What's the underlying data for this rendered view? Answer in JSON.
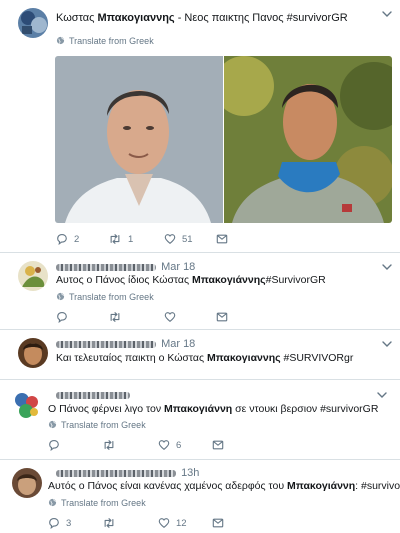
{
  "colors": {
    "icon": "#657786",
    "text": "#14171a",
    "divider": "#d9e0e4"
  },
  "tweets": [
    {
      "author_name": "Κωστας",
      "author_bold": "Μπακογιαννης",
      "body": "- Νεος παικτης Πανος #survivorGR",
      "translate": "Translate from Greek",
      "replies": "2",
      "retweets": "1",
      "likes": "51",
      "photos": [
        "politician-portrait",
        "survivor-contestant-portrait"
      ]
    },
    {
      "date": "Mar 18",
      "body_pre": "Αυτος ο Πάνος ίδιος Κώστας ",
      "body_bold": "Μπακογιάννης",
      "body_post": "#SurvivorGR",
      "translate": "Translate from Greek"
    },
    {
      "date": "Mar 18",
      "body_pre": "Και τελευταίος παικτη ο Κώστας ",
      "body_bold": "Μπακογιαννης",
      "body_post": " #SURVIVORgr"
    },
    {
      "body_pre": "Ο Πάνος φέρνει λιγο τον ",
      "body_bold": "Μπακογιάννη",
      "body_post": " σε ντουκι βερσιον  #survivorGR",
      "translate": "Translate from Greek",
      "likes": "6"
    },
    {
      "date": "13h",
      "body_pre": "Αυτός ο Πάνος είναι κανένας χαμένος αδερφός του ",
      "body_bold": "Μπακογιάννη",
      "body_post": ": #survivorGR",
      "translate": "Translate from Greek",
      "replies": "3",
      "likes": "12"
    }
  ],
  "icons": [
    "reply-icon",
    "retweet-icon",
    "like-icon",
    "message-icon",
    "globe-icon",
    "chevron-down-icon"
  ]
}
